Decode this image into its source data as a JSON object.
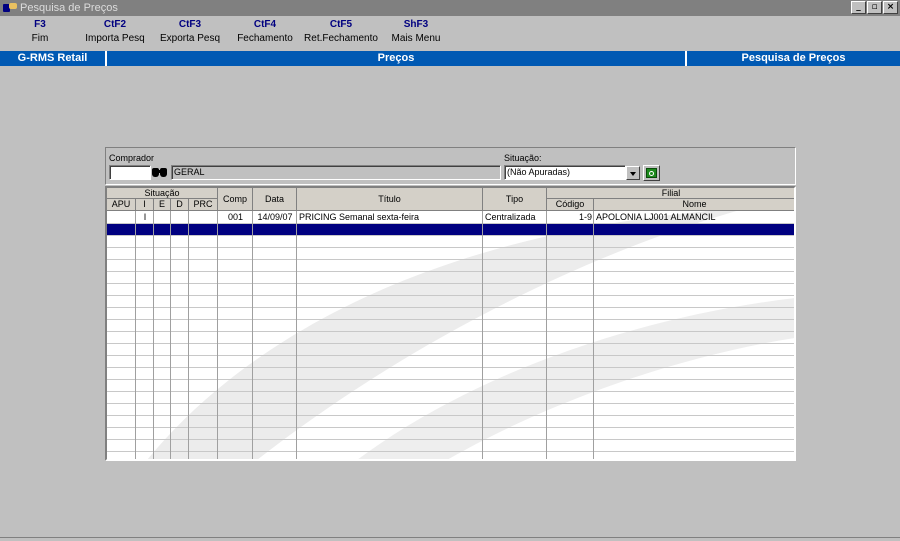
{
  "window": {
    "title": "Pesquisa de Preços",
    "controls": [
      "_",
      "▫",
      "×"
    ]
  },
  "toolbar": [
    {
      "key": "F3",
      "label": "Fim"
    },
    {
      "key": "CtF2",
      "label": "Importa Pesq"
    },
    {
      "key": "CtF3",
      "label": "Exporta Pesq"
    },
    {
      "key": "CtF4",
      "label": "Fechamento"
    },
    {
      "key": "CtF5",
      "label": "Ret.Fechamento"
    },
    {
      "key": "ShF3",
      "label": "Mais Menu"
    }
  ],
  "header": {
    "left": "G-RMS Retail",
    "center": "Preços",
    "right": "Pesquisa de Preços"
  },
  "filters": {
    "comprador_label": "Comprador",
    "comprador_code": "",
    "comprador_name": "GERAL",
    "situacao_label": "Situação:",
    "situacao_value": "(Não Apuradas)"
  },
  "grid": {
    "group_situacao": "Situação",
    "group_filial": "Filial",
    "columns": {
      "apu": "APU",
      "i": "I",
      "e": "E",
      "d": "D",
      "prc": "PRC",
      "comp": "Comp",
      "data": "Data",
      "titulo": "Título",
      "tipo": "Tipo",
      "codigo": "Código",
      "nome": "Nome"
    },
    "rows": [
      {
        "apu": "",
        "i": "I",
        "e": "",
        "d": "",
        "prc": "",
        "comp": "001",
        "data": "14/09/07",
        "titulo": "PRICING Semanal sexta-feira",
        "tipo": "Centralizada",
        "codigo": "1-9",
        "nome": "APOLONIA LJ001 ALMANCIL"
      }
    ]
  },
  "colors": {
    "header_bar": "#0059b3",
    "selection": "#000080",
    "toolbar_key": "#000080"
  }
}
